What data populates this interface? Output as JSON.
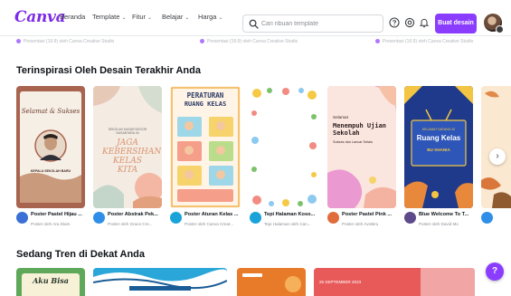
{
  "app": {
    "logo": "Canva"
  },
  "nav": {
    "items": [
      {
        "label": "Beranda",
        "chevron": false
      },
      {
        "label": "Template",
        "chevron": true
      },
      {
        "label": "Fitur",
        "chevron": true
      },
      {
        "label": "Belajar",
        "chevron": true
      },
      {
        "label": "Harga",
        "chevron": true
      }
    ],
    "chevron_glyph": "⌄"
  },
  "search": {
    "placeholder": "Cari ribuan template",
    "icon": "search-icon"
  },
  "toolbar": {
    "help_icon": "help-circle-icon",
    "settings_icon": "gear-icon",
    "notifications_icon": "bell-icon",
    "create_label": "Buat desain"
  },
  "previous_row": {
    "items": [
      "Presentasi (16:9) oleh Canva Creative Studio",
      "Presentasi (16:9) oleh Canva Creative Studio",
      "Presentasi (16:9) oleh Canva Creative Studio"
    ]
  },
  "sections": {
    "inspired_title": "Terinspirasi Oleh Desain Terakhir Anda",
    "trend_title": "Sedang Tren di Dekat Anda"
  },
  "cards": [
    {
      "title": "Poster Pastel Hijau ...",
      "by": "Poster oleh Ara Diam",
      "text": {
        "line1": "Selamat & Sukses",
        "line2": "KEPALA SEKOLAH BARU"
      },
      "colors": {
        "bg": "#a8644f",
        "avatar": "#3b6fd6"
      }
    },
    {
      "title": "Poster Abstrak Pek...",
      "by": "Poster oleh Grace Cre...",
      "text": {
        "line1": "SEKOLAH DASAR BOGOR NUSANTARA 04",
        "line2": "JAGA KEBERSIHAN KELAS KITA"
      },
      "colors": {
        "bg": "#f4ebe3",
        "avatar": "#2f8fe8"
      }
    },
    {
      "title": "Poster Aturan Kelas ...",
      "by": "Poster oleh Canva Creat...",
      "text": {
        "line1": "PERATURAN",
        "line2": "RUANG KELAS"
      },
      "colors": {
        "bg": "#fff4e6",
        "avatar": "#1aa3d9"
      }
    },
    {
      "title": "Tepi Halaman Koso...",
      "by": "Tepi Halaman oleh Can...",
      "text": {},
      "colors": {
        "bg": "#ffffff",
        "avatar": "#1aa3d9"
      }
    },
    {
      "title": "Poster Pastel Pink ...",
      "by": "Poster oleh AvoBiru",
      "text": {
        "line1": "Selamat",
        "line2": "Menempuh Ujian Sekolah",
        "line3": "Sukses dan Lancar Selalu"
      },
      "colors": {
        "bg": "#f8d9d2",
        "avatar": "#e06b3b"
      }
    },
    {
      "title": "Blue Welcome To T...",
      "by": "Poster oleh David Mo",
      "text": {
        "line1": "SELAMAT DATANG DI",
        "line2": "Ruang Kelas",
        "line3": "BU SHANIA"
      },
      "colors": {
        "bg": "#1f3a8a",
        "avatar": "#5c4a8a"
      }
    },
    {
      "title": "",
      "by": "",
      "text": {},
      "colors": {
        "bg": "#fbe8d0",
        "avatar": "#2f8fe8"
      }
    }
  ],
  "scroll_next": {
    "glyph": "›",
    "icon": "chevron-right-icon"
  },
  "trend_cards": [
    {
      "text": "Aku Bisa",
      "colors": {
        "bg": "#5fa85a"
      }
    },
    {
      "text": "",
      "colors": {
        "bg": "#2aa7d8"
      }
    },
    {
      "text": "",
      "colors": {
        "bg": "#e87b2a"
      }
    },
    {
      "text": "25 SEPTEMBER 2023",
      "colors": {
        "bg": "#e85a5a"
      }
    }
  ],
  "help_button": {
    "label": "?"
  },
  "colors": {
    "brand": "#7d2ae8",
    "primary_button": "#8b3dff"
  }
}
